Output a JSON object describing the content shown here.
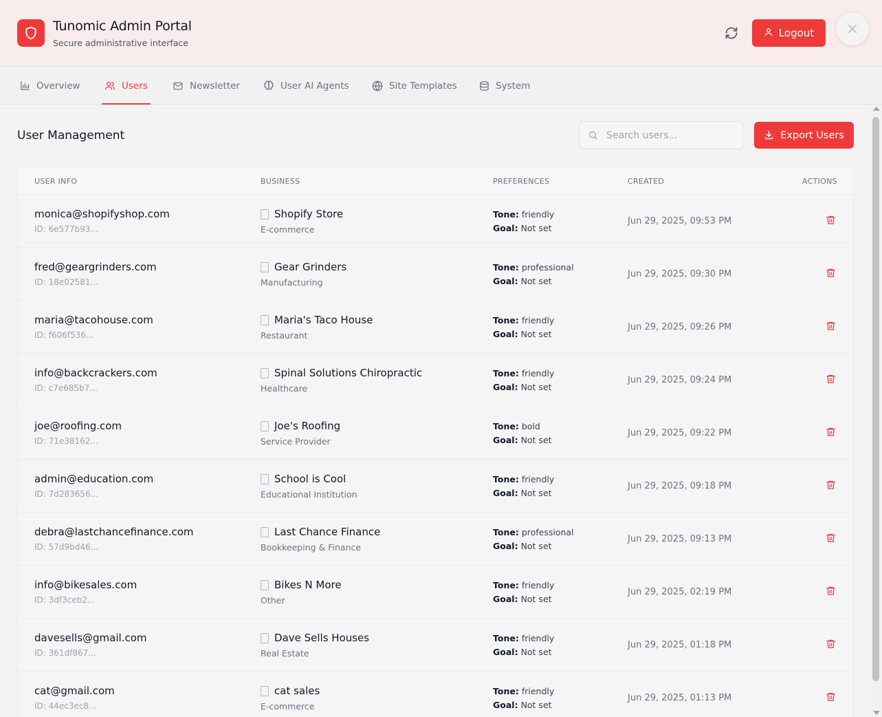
{
  "header": {
    "title": "Tunomic Admin Portal",
    "subtitle": "Secure administrative interface",
    "logout_label": "Logout",
    "icons": {
      "logo": "shield-icon",
      "refresh": "refresh-icon",
      "logout": "user-icon",
      "close": "close-icon"
    }
  },
  "colors": {
    "accent": "#ef3a3a",
    "header_bg": "#f8ecec"
  },
  "tabs": [
    {
      "label": "Overview",
      "icon": "bar-chart-icon",
      "active": false
    },
    {
      "label": "Users",
      "icon": "users-icon",
      "active": true
    },
    {
      "label": "Newsletter",
      "icon": "mail-icon",
      "active": false
    },
    {
      "label": "User AI Agents",
      "icon": "brain-icon",
      "active": false
    },
    {
      "label": "Site Templates",
      "icon": "globe-icon",
      "active": false
    },
    {
      "label": "System",
      "icon": "database-icon",
      "active": false
    }
  ],
  "main": {
    "section_title": "User Management",
    "search_placeholder": "Search users...",
    "search_value": "",
    "export_label": "Export Users"
  },
  "table": {
    "columns": [
      "USER INFO",
      "BUSINESS",
      "PREFERENCES",
      "CREATED",
      "ACTIONS"
    ],
    "tone_label": "Tone:",
    "goal_label": "Goal:",
    "rows": [
      {
        "email": "monica@shopifyshop.com",
        "id": "ID: 6e577b93...",
        "business": "Shopify Store",
        "type": "E-commerce",
        "tone": "friendly",
        "goal": "Not set",
        "created": "Jun 29, 2025, 09:53 PM"
      },
      {
        "email": "fred@geargrinders.com",
        "id": "ID: 18e02581...",
        "business": "Gear Grinders",
        "type": "Manufacturing",
        "tone": "professional",
        "goal": "Not set",
        "created": "Jun 29, 2025, 09:30 PM"
      },
      {
        "email": "maria@tacohouse.com",
        "id": "ID: f606f536...",
        "business": "Maria's Taco House",
        "type": "Restaurant",
        "tone": "friendly",
        "goal": "Not set",
        "created": "Jun 29, 2025, 09:26 PM"
      },
      {
        "email": "info@backcrackers.com",
        "id": "ID: c7e685b7...",
        "business": "Spinal Solutions Chiropractic",
        "type": "Healthcare",
        "tone": "friendly",
        "goal": "Not set",
        "created": "Jun 29, 2025, 09:24 PM"
      },
      {
        "email": "joe@roofing.com",
        "id": "ID: 71e38162...",
        "business": "Joe's Roofing",
        "type": "Service Provider",
        "tone": "bold",
        "goal": "Not set",
        "created": "Jun 29, 2025, 09:22 PM"
      },
      {
        "email": "admin@education.com",
        "id": "ID: 7d283656...",
        "business": "School is Cool",
        "type": "Educational Institution",
        "tone": "friendly",
        "goal": "Not set",
        "created": "Jun 29, 2025, 09:18 PM"
      },
      {
        "email": "debra@lastchancefinance.com",
        "id": "ID: 57d9bd46...",
        "business": "Last Chance Finance",
        "type": "Bookkeeping & Finance",
        "tone": "professional",
        "goal": "Not set",
        "created": "Jun 29, 2025, 09:13 PM"
      },
      {
        "email": "info@bikesales.com",
        "id": "ID: 3df3ceb2...",
        "business": "Bikes N More",
        "type": "Other",
        "tone": "friendly",
        "goal": "Not set",
        "created": "Jun 29, 2025, 02:19 PM"
      },
      {
        "email": "davesells@gmail.com",
        "id": "ID: 361df867...",
        "business": "Dave Sells Houses",
        "type": "Real Estate",
        "tone": "friendly",
        "goal": "Not set",
        "created": "Jun 29, 2025, 01:18 PM"
      },
      {
        "email": "cat@gmail.com",
        "id": "ID: 44ec3ec8...",
        "business": "cat sales",
        "type": "E-commerce",
        "tone": "friendly",
        "goal": "Not set",
        "created": "Jun 29, 2025, 01:13 PM"
      }
    ]
  }
}
